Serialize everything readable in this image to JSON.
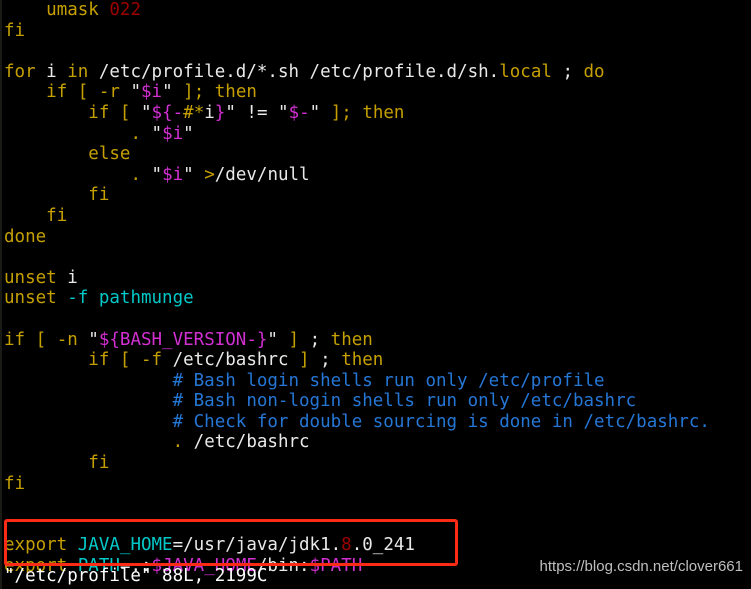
{
  "terminal": {
    "editor": "vim",
    "colors": {
      "background": "#000000",
      "keyword": "#c5a000",
      "string": "#e9e9e9",
      "variable": "#d330d3",
      "number": "#9c0000",
      "comment": "#2577d6",
      "identifier": "#00c8c8",
      "annotation_box": "#fb2b16",
      "watermark": "#cfcfcf"
    },
    "lines": [
      {
        "id": "line-umask",
        "segments": [
          {
            "t": "    ",
            "c": "str"
          },
          {
            "t": "umask ",
            "c": "kw"
          },
          {
            "t": "022",
            "c": "num"
          }
        ]
      },
      {
        "id": "line-fi-1",
        "segments": [
          {
            "t": "fi",
            "c": "kw"
          }
        ]
      },
      {
        "id": "line-blank-1",
        "segments": [
          {
            "t": "",
            "c": "str"
          }
        ]
      },
      {
        "id": "line-for",
        "segments": [
          {
            "t": "for ",
            "c": "kw"
          },
          {
            "t": "i ",
            "c": "str"
          },
          {
            "t": "in ",
            "c": "kw"
          },
          {
            "t": "/etc/profile.d/*.sh /etc/profile.d/sh.",
            "c": "str"
          },
          {
            "t": "local",
            "c": "kw"
          },
          {
            "t": " ; ",
            "c": "str"
          },
          {
            "t": "do",
            "c": "kw"
          }
        ]
      },
      {
        "id": "line-if-r",
        "segments": [
          {
            "t": "    ",
            "c": "str"
          },
          {
            "t": "if ",
            "c": "kw"
          },
          {
            "t": "[ ",
            "c": "kw"
          },
          {
            "t": "-r ",
            "c": "kw"
          },
          {
            "t": "\"",
            "c": "str"
          },
          {
            "t": "$i",
            "c": "var"
          },
          {
            "t": "\" ",
            "c": "str"
          },
          {
            "t": "]; ",
            "c": "kw"
          },
          {
            "t": "then",
            "c": "kw"
          }
        ]
      },
      {
        "id": "line-if-dash",
        "segments": [
          {
            "t": "        ",
            "c": "str"
          },
          {
            "t": "if ",
            "c": "kw"
          },
          {
            "t": "[ ",
            "c": "kw"
          },
          {
            "t": "\"",
            "c": "str"
          },
          {
            "t": "${",
            "c": "var"
          },
          {
            "t": "-",
            "c": "var"
          },
          {
            "t": "#*",
            "c": "kw"
          },
          {
            "t": "i",
            "c": "str"
          },
          {
            "t": "}",
            "c": "var"
          },
          {
            "t": "\" ",
            "c": "str"
          },
          {
            "t": "!= ",
            "c": "str"
          },
          {
            "t": "\"",
            "c": "str"
          },
          {
            "t": "$-",
            "c": "var"
          },
          {
            "t": "\" ",
            "c": "str"
          },
          {
            "t": "]; ",
            "c": "kw"
          },
          {
            "t": "then",
            "c": "kw"
          }
        ]
      },
      {
        "id": "line-source-i",
        "segments": [
          {
            "t": "            ",
            "c": "str"
          },
          {
            "t": ". ",
            "c": "kw"
          },
          {
            "t": "\"",
            "c": "str"
          },
          {
            "t": "$i",
            "c": "var"
          },
          {
            "t": "\"",
            "c": "str"
          }
        ]
      },
      {
        "id": "line-else",
        "segments": [
          {
            "t": "        ",
            "c": "str"
          },
          {
            "t": "else",
            "c": "kw"
          }
        ]
      },
      {
        "id": "line-source-null",
        "segments": [
          {
            "t": "            ",
            "c": "str"
          },
          {
            "t": ". ",
            "c": "kw"
          },
          {
            "t": "\"",
            "c": "str"
          },
          {
            "t": "$i",
            "c": "var"
          },
          {
            "t": "\" ",
            "c": "str"
          },
          {
            "t": ">",
            "c": "kw"
          },
          {
            "t": "/dev/null",
            "c": "str"
          }
        ]
      },
      {
        "id": "line-fi-2",
        "segments": [
          {
            "t": "        ",
            "c": "str"
          },
          {
            "t": "fi",
            "c": "kw"
          }
        ]
      },
      {
        "id": "line-fi-3",
        "segments": [
          {
            "t": "    ",
            "c": "str"
          },
          {
            "t": "fi",
            "c": "kw"
          }
        ]
      },
      {
        "id": "line-done",
        "segments": [
          {
            "t": "done",
            "c": "kw"
          }
        ]
      },
      {
        "id": "line-blank-2",
        "segments": [
          {
            "t": "",
            "c": "str"
          }
        ]
      },
      {
        "id": "line-unset-i",
        "segments": [
          {
            "t": "unset ",
            "c": "kw"
          },
          {
            "t": "i",
            "c": "str"
          }
        ]
      },
      {
        "id": "line-unset-f",
        "segments": [
          {
            "t": "unset ",
            "c": "kw"
          },
          {
            "t": "-f",
            "c": "ident"
          },
          {
            "t": " ",
            "c": "str"
          },
          {
            "t": "pathmunge",
            "c": "ident"
          }
        ]
      },
      {
        "id": "line-blank-3",
        "segments": [
          {
            "t": "",
            "c": "str"
          }
        ]
      },
      {
        "id": "line-if-bash-ver",
        "segments": [
          {
            "t": "if ",
            "c": "kw"
          },
          {
            "t": "[ ",
            "c": "kw"
          },
          {
            "t": "-n ",
            "c": "kw"
          },
          {
            "t": "\"",
            "c": "str"
          },
          {
            "t": "${BASH_VERSION-}",
            "c": "var"
          },
          {
            "t": "\" ",
            "c": "str"
          },
          {
            "t": "] ",
            "c": "kw"
          },
          {
            "t": "; ",
            "c": "str"
          },
          {
            "t": "then",
            "c": "kw"
          }
        ]
      },
      {
        "id": "line-if-f-bashrc",
        "segments": [
          {
            "t": "        ",
            "c": "str"
          },
          {
            "t": "if ",
            "c": "kw"
          },
          {
            "t": "[ ",
            "c": "kw"
          },
          {
            "t": "-f ",
            "c": "kw"
          },
          {
            "t": "/etc/bashrc ",
            "c": "str"
          },
          {
            "t": "] ",
            "c": "kw"
          },
          {
            "t": "; ",
            "c": "str"
          },
          {
            "t": "then",
            "c": "kw"
          }
        ]
      },
      {
        "id": "line-comment-1",
        "segments": [
          {
            "t": "                ",
            "c": "str"
          },
          {
            "t": "# Bash login shells run only /etc/profile",
            "c": "cmt"
          }
        ]
      },
      {
        "id": "line-comment-2",
        "segments": [
          {
            "t": "                ",
            "c": "str"
          },
          {
            "t": "# Bash non-login shells run only /etc/bashrc",
            "c": "cmt"
          }
        ]
      },
      {
        "id": "line-comment-3",
        "segments": [
          {
            "t": "                ",
            "c": "str"
          },
          {
            "t": "# Check for double sourcing is done in /etc/bashrc.",
            "c": "cmt"
          }
        ]
      },
      {
        "id": "line-source-bashrc",
        "segments": [
          {
            "t": "                ",
            "c": "str"
          },
          {
            "t": ". ",
            "c": "kw"
          },
          {
            "t": "/etc/bashrc",
            "c": "str"
          }
        ]
      },
      {
        "id": "line-fi-4",
        "segments": [
          {
            "t": "        ",
            "c": "str"
          },
          {
            "t": "fi",
            "c": "kw"
          }
        ]
      },
      {
        "id": "line-fi-5",
        "segments": [
          {
            "t": "fi",
            "c": "kw"
          }
        ]
      },
      {
        "id": "line-blank-4",
        "segments": [
          {
            "t": "",
            "c": "str"
          }
        ]
      },
      {
        "id": "line-blank-5",
        "segments": [
          {
            "t": "",
            "c": "str"
          }
        ]
      },
      {
        "id": "line-export-java-home",
        "segments": [
          {
            "t": "export ",
            "c": "kw"
          },
          {
            "t": "JAVA_HOME",
            "c": "ident"
          },
          {
            "t": "=/usr/java/jdk1.",
            "c": "str"
          },
          {
            "t": "8",
            "c": "num"
          },
          {
            "t": ".0_241",
            "c": "str"
          }
        ]
      },
      {
        "id": "line-export-path",
        "segments": [
          {
            "t": "export ",
            "c": "kw"
          },
          {
            "t": "PATH",
            "c": "ident"
          },
          {
            "t": "=.:",
            "c": "str"
          },
          {
            "t": "$JAVA_HOME",
            "c": "var"
          },
          {
            "t": "/bin:",
            "c": "str"
          },
          {
            "t": "$PATH",
            "c": "var"
          }
        ]
      }
    ],
    "status_line": "\"/etc/profile\" 88L, 2199C"
  },
  "annotation": {
    "box_label": "highlighted-export-lines"
  },
  "watermark": {
    "text": "https://blog.csdn.net/clover661"
  }
}
